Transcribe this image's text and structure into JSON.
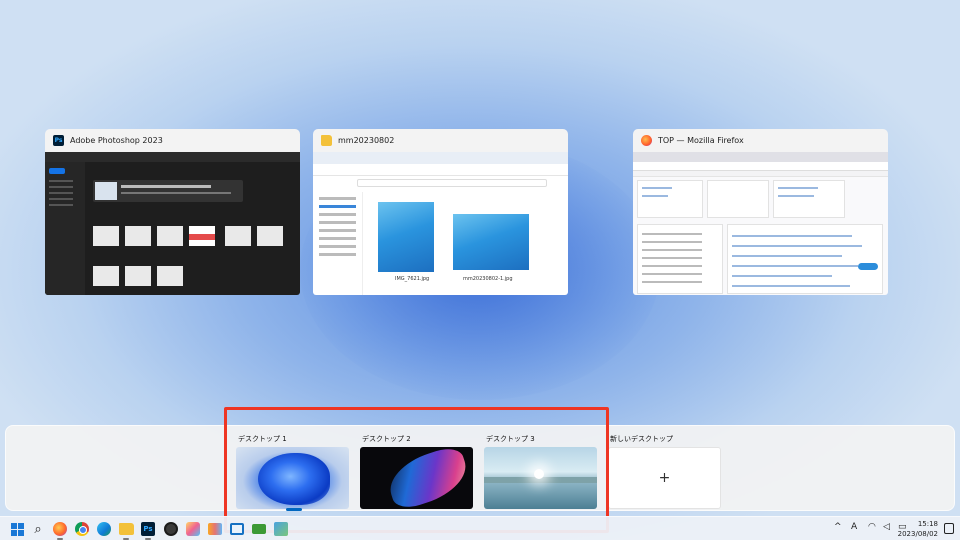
{
  "windows": [
    {
      "title": "Adobe Photoshop 2023",
      "icon": "photoshop-icon"
    },
    {
      "title": "mm20230802",
      "icon": "folder-icon",
      "files": [
        "IMG_7621.jpg",
        "mm20230802-1.jpg"
      ]
    },
    {
      "title": "TOP — Mozilla Firefox",
      "icon": "firefox-icon"
    }
  ],
  "desktops": [
    {
      "label": "デスクトップ 1",
      "current": true
    },
    {
      "label": "デスクトップ 2",
      "current": false
    },
    {
      "label": "デスクトップ 3",
      "current": false
    }
  ],
  "new_desktop": {
    "label": "新しいデスクトップ",
    "plus": "+"
  },
  "taskbar": {
    "icons": [
      "start-icon",
      "search-icon",
      "firefox-icon",
      "chrome-icon",
      "edge-icon",
      "file-explorer-icon",
      "photoshop-icon",
      "globe-icon",
      "paint-icon",
      "book-icon",
      "remote-desktop-icon",
      "green-app-icon",
      "mixed-app-icon"
    ],
    "tray_chevron": "^",
    "ime": "A",
    "clock_time": "15:18",
    "clock_date": "2023/08/02"
  },
  "colors": {
    "highlight": "#ee3523",
    "accent": "#0067c0"
  }
}
